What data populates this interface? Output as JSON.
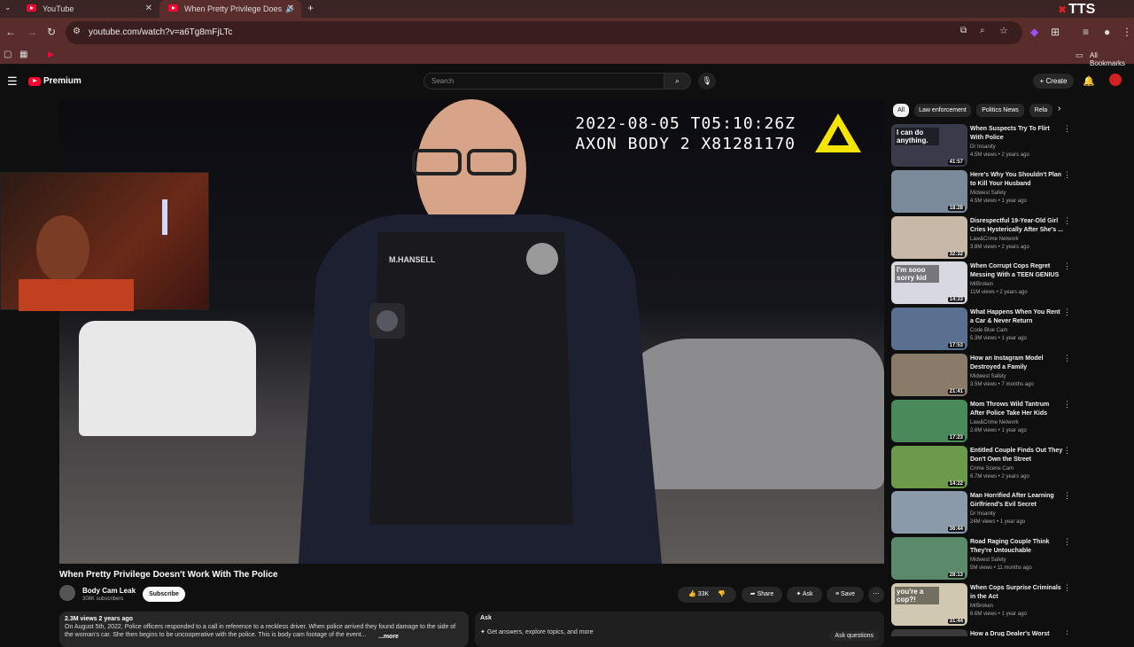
{
  "browser": {
    "tabs": [
      {
        "title": "YouTube"
      },
      {
        "title": "When Pretty Privilege Does"
      }
    ],
    "url": "youtube.com/watch?v=a6Tg8mFjLTc",
    "bookmarks_label": "All Bookmarks",
    "tts_badge": "TTS"
  },
  "youtube": {
    "logo_text": "Premium",
    "search_placeholder": "Search",
    "create_label": "Create"
  },
  "video": {
    "timestamp_line1": "2022-08-05 T05:10:26Z",
    "timestamp_line2": "AXON BODY 2 X81281170",
    "nametag": "M.HANSELL",
    "title": "When Pretty Privilege Doesn't Work With The Police",
    "channel": "Body Cam Leak",
    "subscribers": "308K subscribers",
    "subscribe_label": "Subscribe",
    "likes": "33K",
    "share_label": "Share",
    "ask_label": "Ask",
    "save_label": "Save",
    "description_meta": "2.3M views  2 years ago",
    "description_text": "On August 5th, 2022, Police officers responded to a call in reference to a reckless driver. When police arrived they found damage to the side of the woman's car. She then begins to be uncooperative with the police. This is body cam footage of the event...",
    "description_more": "...more",
    "ask_header": "Ask",
    "ask_prompt": "Get answers, explore topics, and more",
    "ask_questions": "Ask questions"
  },
  "chips": [
    "All",
    "Law enforcement",
    "Politics News",
    "Rela"
  ],
  "recommendations": [
    {
      "title": "When Suspects Try To Flirt With Police",
      "channel": "Dr Insanity",
      "views": "4.5M views • 2 years ago",
      "duration": "41:57",
      "color": "#3a3a4a"
    },
    {
      "title": "Here's Why You Shouldn't Plan to Kill Your Husband",
      "channel": "Midwest Safety",
      "views": "4.5M views • 1 year ago",
      "duration": "18:28",
      "color": "#7a8a9a"
    },
    {
      "title": "Disrespectful 19-Year-Old Girl Cries Hysterically After She's ...",
      "channel": "Law&Crime Network",
      "views": "3.8M views • 2 years ago",
      "duration": "32:32",
      "color": "#c8b8a8"
    },
    {
      "title": "When Corrupt Cops Regret Messing With a TEEN GENIUS",
      "channel": "MrBroken",
      "views": "11M views • 2 years ago",
      "duration": "14:33",
      "color": "#d8d8e0"
    },
    {
      "title": "What Happens When You Rent a Car & Never Return",
      "channel": "Code Blue Cam",
      "views": "5.3M views • 1 year ago",
      "duration": "17:53",
      "color": "#5a7090"
    },
    {
      "title": "How an Instagram Model Destroyed a Family",
      "channel": "Midwest Safety",
      "views": "3.5M views • 7 months ago",
      "duration": "21:41",
      "color": "#8a7a6a"
    },
    {
      "title": "Mom Throws Wild Tantrum After Police Take Her Kids",
      "channel": "Law&Crime Network",
      "views": "2.6M views • 1 year ago",
      "duration": "17:23",
      "color": "#4a8a5a"
    },
    {
      "title": "Entitled Couple Finds Out They Don't Own the Street",
      "channel": "Crime Scene Cam",
      "views": "6.7M views • 2 years ago",
      "duration": "14:22",
      "color": "#6a9a4a"
    },
    {
      "title": "Man Horrified After Learning Girlfriend's Evil Secret",
      "channel": "Dr Insanity",
      "views": "24M views • 1 year ago",
      "duration": "36:44",
      "color": "#8a9aaa"
    },
    {
      "title": "Road Raging Couple Think They're Untouchable",
      "channel": "Midwest Safety",
      "views": "5M views • 11 months ago",
      "duration": "28:13",
      "color": "#5a8a6a"
    },
    {
      "title": "When Cops Surprise Criminals in the Act",
      "channel": "MrBroken",
      "views": "6.6M views • 1 year ago",
      "duration": "31:44",
      "color": "#d0c8b0"
    },
    {
      "title": "How a Drug Dealer's Worst",
      "channel": "",
      "views": "",
      "duration": "",
      "color": "#3a3a3a"
    }
  ],
  "thumb_captions": {
    "t0": "I can do anything.",
    "t3": "I'm sooo sorry kid",
    "t10": "you're a cop?!"
  }
}
